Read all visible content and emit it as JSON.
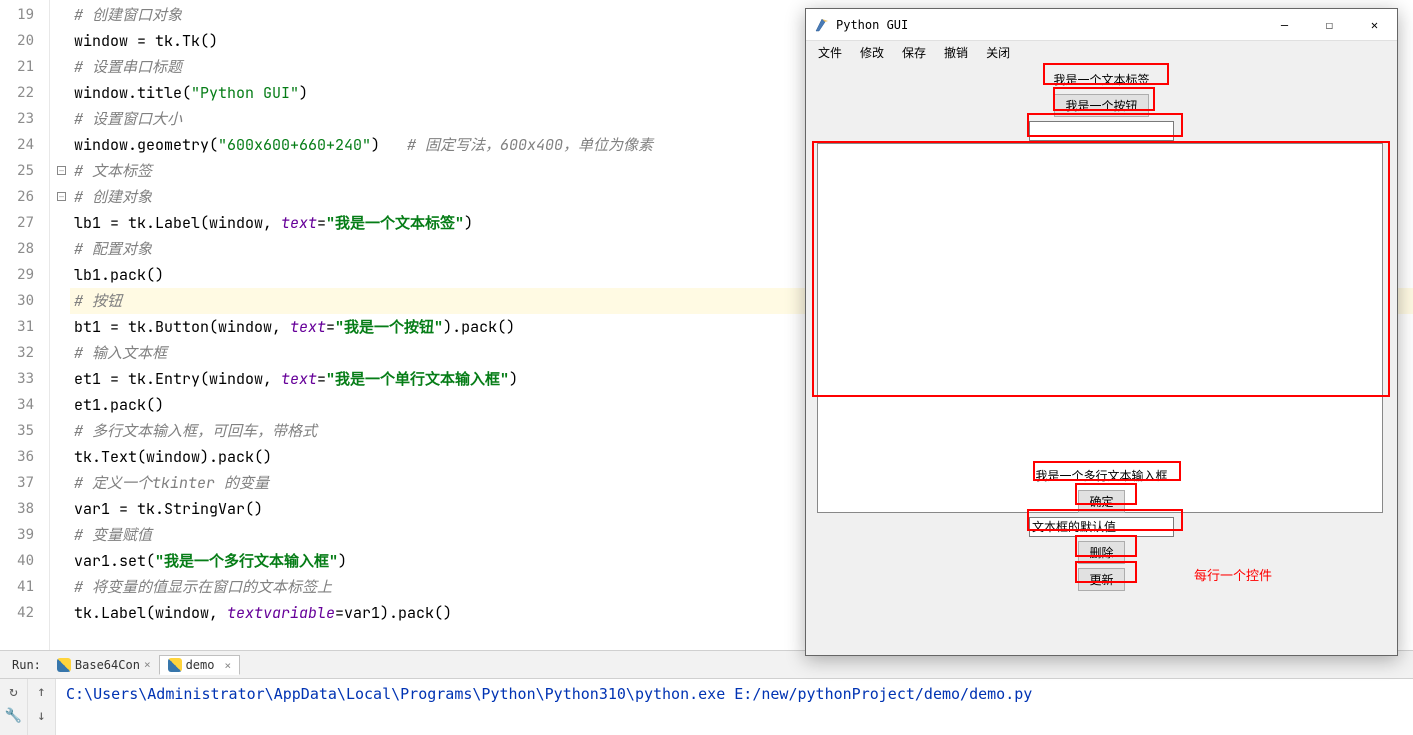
{
  "gutter": [
    "19",
    "20",
    "21",
    "22",
    "23",
    "24",
    "25",
    "26",
    "27",
    "28",
    "29",
    "30",
    "31",
    "32",
    "33",
    "34",
    "35",
    "36",
    "37",
    "38",
    "39",
    "40",
    "41",
    "42"
  ],
  "code": {
    "l19": "# 创建窗口对象",
    "l20a": "window = tk.Tk()",
    "l21": "# 设置串口标题",
    "l22a": "window.title(",
    "l22b": "\"Python GUI\"",
    "l22c": ")",
    "l23": "# 设置窗口大小",
    "l24a": "window.geometry(",
    "l24b": "\"600x600+660+240\"",
    "l24c": ")   ",
    "l24d": "# 固定写法，600x400，单位为像素",
    "l25": "# 文本标签",
    "l26": "# 创建对象",
    "l27a": "lb1 = tk.Label(window, ",
    "l27b": "text",
    "l27c": "=",
    "l27d": "\"我是一个文本标签\"",
    "l27e": ")",
    "l28": "# 配置对象",
    "l29": "lb1.pack()",
    "l30": "# 按钮",
    "l31a": "bt1 = tk.Button(window, ",
    "l31b": "text",
    "l31c": "=",
    "l31d": "\"我是一个按钮\"",
    "l31e": ").pack()",
    "l32": "# 输入文本框",
    "l33a": "et1 = tk.Entry(window, ",
    "l33b": "text",
    "l33c": "=",
    "l33d": "\"我是一个单行文本输入框\"",
    "l33e": ")",
    "l34": "et1.pack()",
    "l35": "# 多行文本输入框，可回车，带格式",
    "l36": "tk.Text(window).pack()",
    "l37": "# 定义一个tkinter 的变量",
    "l38": "var1 = tk.StringVar()",
    "l39": "# 变量赋值",
    "l40a": "var1.set(",
    "l40b": "\"我是一个多行文本输入框\"",
    "l40c": ")",
    "l41": "# 将变量的值显示在窗口的文本标签上",
    "l42a": "tk.Label(window, ",
    "l42b": "textvariable",
    "l42c": "=var1).pack()"
  },
  "run": {
    "label": "Run:",
    "tab1": "Base64Con",
    "tab2": "demo",
    "output": "C:\\Users\\Administrator\\AppData\\Local\\Programs\\Python\\Python310\\python.exe E:/new/pythonProject/demo/demo.py"
  },
  "gui": {
    "title": "Python GUI",
    "menu": {
      "m1": "文件",
      "m2": "修改",
      "m3": "保存",
      "m4": "撤销",
      "m5": "关闭"
    },
    "label1": "我是一个文本标签",
    "button1": "我是一个按钮",
    "multiline_label": "我是一个多行文本输入框",
    "ok_btn": "确定",
    "entry_default": "文本框的默认值",
    "delete_btn": "删除",
    "update_btn": "更新",
    "annotation": "每行一个控件"
  }
}
